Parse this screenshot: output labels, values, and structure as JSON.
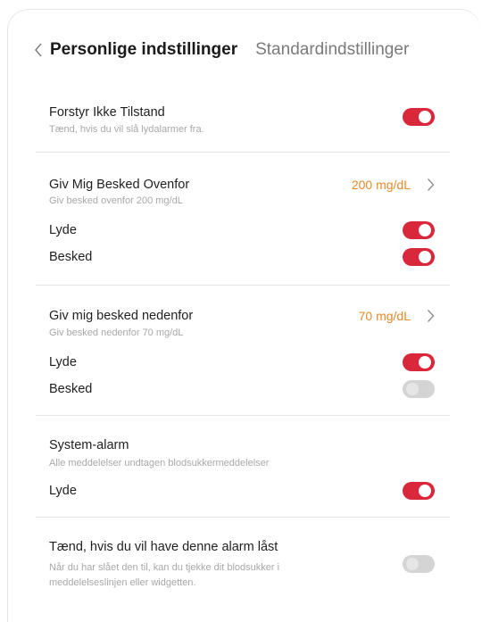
{
  "header": {
    "active_tab": "Personlige indstillinger",
    "inactive_tab": "Standardindstillinger"
  },
  "dnd": {
    "title": "Forstyr Ikke Tilstand",
    "subtitle": "Tænd, hvis du vil slå lydalarmer fra.",
    "toggle_on": true
  },
  "high_alert": {
    "title": "Giv Mig Besked Ovenfor",
    "value": "200 mg/dL",
    "subtitle": "Giv besked ovenfor 200 mg/dL",
    "sound_label": "Lyde",
    "sound_on": true,
    "notify_label": "Besked",
    "notify_on": true
  },
  "low_alert": {
    "title": "Giv mig besked nedenfor",
    "value": "70 mg/dL",
    "subtitle": "Giv besked nedenfor 70 mg/dL",
    "sound_label": "Lyde",
    "sound_on": true,
    "notify_label": "Besked",
    "notify_on": false
  },
  "system_alarm": {
    "title": "System-alarm",
    "subtitle": "Alle meddelelser undtagen blodsukkermeddelelser",
    "sound_label": "Lyde",
    "sound_on": true
  },
  "lock_alarm": {
    "title": "Tænd, hvis du vil have denne alarm låst",
    "subtitle_line1": "Når du har slået den til, kan du tjekke dit blodsukker i",
    "subtitle_line2": "meddelelseslinjen eller widgetten.",
    "toggle_on": false
  },
  "colors": {
    "toggle_on": "#d9283b",
    "toggle_off": "#d4d4d4",
    "value": "#e58a2a"
  }
}
